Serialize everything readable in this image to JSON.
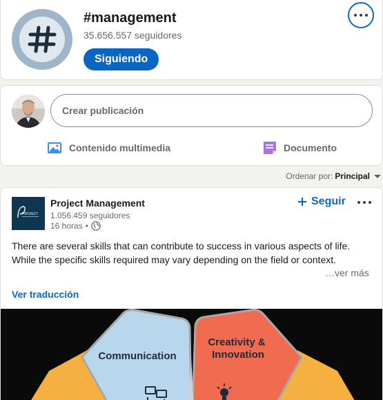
{
  "hashtag": {
    "title": "#management",
    "followers": "35.656.557 seguidores",
    "following_label": "Siguiendo",
    "icon": "hashtag-icon",
    "more_icon": "more-horizontal-icon"
  },
  "composer": {
    "placeholder": "Crear publicación",
    "actions": [
      {
        "label": "Contenido multimedia",
        "icon": "image-icon",
        "color": "#378fe9"
      },
      {
        "label": "Documento",
        "icon": "document-icon",
        "color": "#a872e8"
      }
    ]
  },
  "sort": {
    "label": "Ordenar por:",
    "value": "Principal"
  },
  "post": {
    "author": "Project Management",
    "author_followers": "1.056.459 seguidores",
    "time": "16 horas",
    "visibility_icon": "globe-icon",
    "follow_label": "Seguir",
    "text_lines": [
      "There are several skills that can contribute to success in various aspects of life.",
      "While the specific skills required may vary depending on the field or context."
    ],
    "see_more": "…ver más",
    "translate": "Ver traducción",
    "logo_text": "PROJECT",
    "image": {
      "segments": [
        {
          "label_line1": "Communication",
          "label_line2": "",
          "color": "#b8d6ec",
          "icon": "people-icon"
        },
        {
          "label_line1": "Creativity &",
          "label_line2": "Innovation",
          "color": "#f06b4f",
          "icon": "lightbulb-icon"
        }
      ],
      "side_color": "#f5b041"
    }
  },
  "colors": {
    "accent": "#0a66c2",
    "background": "#f4f2ee"
  }
}
